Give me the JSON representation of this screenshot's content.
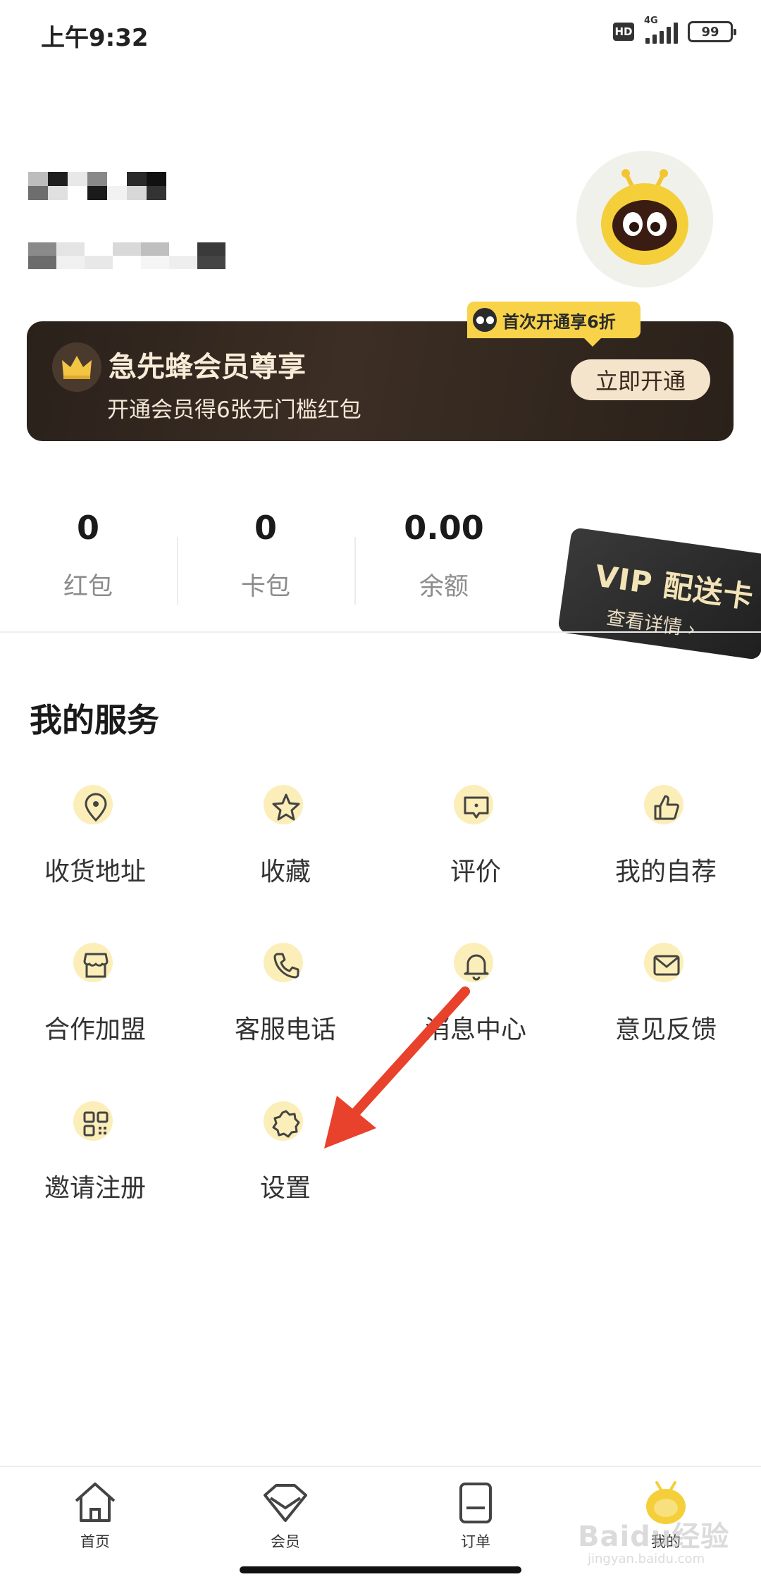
{
  "status_bar": {
    "time": "上午9:32",
    "hd": "HD",
    "network": "4G",
    "battery": "99"
  },
  "vip_banner": {
    "title": "急先蜂会员尊享",
    "subtitle": "开通会员得6张无门槛红包",
    "button_label": "立即开通",
    "promo_tag": "首次开通享6折"
  },
  "stats": [
    {
      "value": "0",
      "label": "红包"
    },
    {
      "value": "0",
      "label": "卡包"
    },
    {
      "value": "0.00",
      "label": "余额"
    }
  ],
  "vip_card": {
    "title": "VIP 配送卡",
    "link": "查看详情"
  },
  "services": {
    "title": "我的服务",
    "items": [
      {
        "label": "收货地址",
        "icon": "location-pin-icon"
      },
      {
        "label": "收藏",
        "icon": "star-icon"
      },
      {
        "label": "评价",
        "icon": "comment-icon"
      },
      {
        "label": "我的自荐",
        "icon": "thumbs-up-icon"
      },
      {
        "label": "合作加盟",
        "icon": "shop-icon"
      },
      {
        "label": "客服电话",
        "icon": "phone-icon"
      },
      {
        "label": "消息中心",
        "icon": "bell-icon"
      },
      {
        "label": "意见反馈",
        "icon": "mail-icon"
      },
      {
        "label": "邀请注册",
        "icon": "qr-code-icon"
      },
      {
        "label": "设置",
        "icon": "gear-icon"
      }
    ]
  },
  "tabbar": {
    "items": [
      {
        "label": "首页",
        "icon": "home-icon"
      },
      {
        "label": "会员",
        "icon": "diamond-icon"
      },
      {
        "label": "订单",
        "icon": "order-icon"
      },
      {
        "label": "我的",
        "icon": "bee-icon"
      }
    ]
  },
  "watermark": {
    "text": "Baidu经验",
    "sub": "jingyan.baidu.com"
  },
  "colors": {
    "accent_yellow": "#f8d34a",
    "icon_bg": "#fbeeb8",
    "banner_dark": "#2a211b",
    "annotation_red": "#e8412c"
  }
}
